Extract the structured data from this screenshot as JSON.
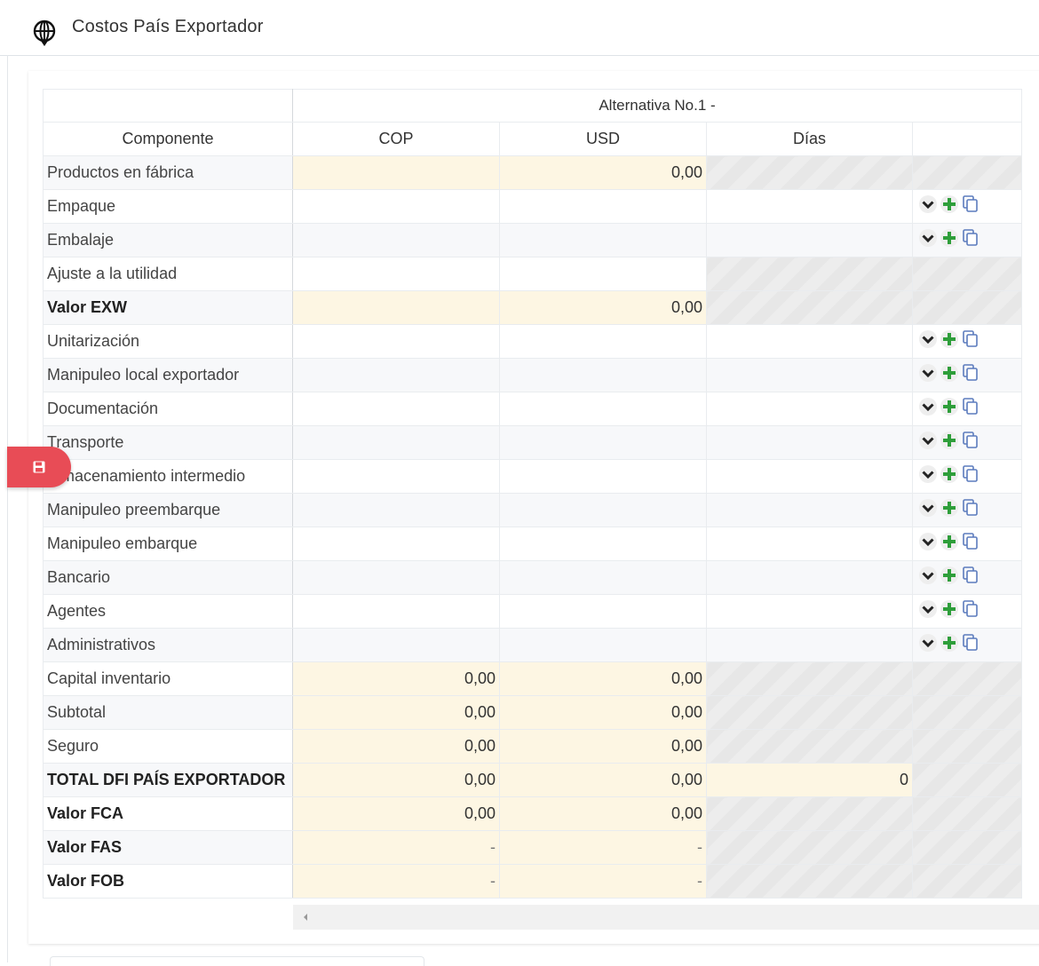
{
  "header": {
    "title": "Costos País Exportador",
    "icon": "globe-icon"
  },
  "table": {
    "alternative_label": "Alternativa No.1 -",
    "columns": [
      "Componente",
      "COP",
      "USD",
      "Días",
      ""
    ],
    "rows": [
      {
        "label": "Productos en fábrica",
        "bold": false,
        "cop": "",
        "usd": "0,00",
        "dias": "",
        "cop_style": "yellow",
        "usd_style": "yellow",
        "dias_style": "hatch",
        "actions": false
      },
      {
        "label": "Empaque",
        "bold": false,
        "cop": "",
        "usd": "",
        "dias": "",
        "cop_style": "plain",
        "usd_style": "plain",
        "dias_style": "plain",
        "actions": true
      },
      {
        "label": "Embalaje",
        "bold": false,
        "cop": "",
        "usd": "",
        "dias": "",
        "cop_style": "plain",
        "usd_style": "plain",
        "dias_style": "plain",
        "actions": true
      },
      {
        "label": "Ajuste a la utilidad",
        "bold": false,
        "cop": "",
        "usd": "",
        "dias": "",
        "cop_style": "plain",
        "usd_style": "plain",
        "dias_style": "hatch",
        "actions": false
      },
      {
        "label": "Valor EXW",
        "bold": true,
        "cop": "",
        "usd": "0,00",
        "dias": "",
        "cop_style": "yellow",
        "usd_style": "yellow",
        "dias_style": "hatch",
        "actions": false
      },
      {
        "label": "Unitarización",
        "bold": false,
        "cop": "",
        "usd": "",
        "dias": "",
        "cop_style": "plain",
        "usd_style": "plain",
        "dias_style": "plain",
        "actions": true
      },
      {
        "label": "Manipuleo local exportador",
        "bold": false,
        "cop": "",
        "usd": "",
        "dias": "",
        "cop_style": "plain",
        "usd_style": "plain",
        "dias_style": "plain",
        "actions": true
      },
      {
        "label": "Documentación",
        "bold": false,
        "cop": "",
        "usd": "",
        "dias": "",
        "cop_style": "plain",
        "usd_style": "plain",
        "dias_style": "plain",
        "actions": true
      },
      {
        "label": "Transporte",
        "bold": false,
        "cop": "",
        "usd": "",
        "dias": "",
        "cop_style": "plain",
        "usd_style": "plain",
        "dias_style": "plain",
        "actions": true
      },
      {
        "label": "Almacenamiento intermedio",
        "bold": false,
        "cop": "",
        "usd": "",
        "dias": "",
        "cop_style": "plain",
        "usd_style": "plain",
        "dias_style": "plain",
        "actions": true
      },
      {
        "label": "Manipuleo preembarque",
        "bold": false,
        "cop": "",
        "usd": "",
        "dias": "",
        "cop_style": "plain",
        "usd_style": "plain",
        "dias_style": "plain",
        "actions": true
      },
      {
        "label": "Manipuleo embarque",
        "bold": false,
        "cop": "",
        "usd": "",
        "dias": "",
        "cop_style": "plain",
        "usd_style": "plain",
        "dias_style": "plain",
        "actions": true
      },
      {
        "label": "Bancario",
        "bold": false,
        "cop": "",
        "usd": "",
        "dias": "",
        "cop_style": "plain",
        "usd_style": "plain",
        "dias_style": "plain",
        "actions": true
      },
      {
        "label": "Agentes",
        "bold": false,
        "cop": "",
        "usd": "",
        "dias": "",
        "cop_style": "plain",
        "usd_style": "plain",
        "dias_style": "plain",
        "actions": true
      },
      {
        "label": "Administrativos",
        "bold": false,
        "cop": "",
        "usd": "",
        "dias": "",
        "cop_style": "plain",
        "usd_style": "plain",
        "dias_style": "plain",
        "actions": true
      },
      {
        "label": "Capital inventario",
        "bold": false,
        "cop": "0,00",
        "usd": "0,00",
        "dias": "",
        "cop_style": "yellow",
        "usd_style": "yellow",
        "dias_style": "hatch",
        "actions": false
      },
      {
        "label": "Subtotal",
        "bold": false,
        "cop": "0,00",
        "usd": "0,00",
        "dias": "",
        "cop_style": "yellow",
        "usd_style": "yellow",
        "dias_style": "hatch",
        "actions": false
      },
      {
        "label": "Seguro",
        "bold": false,
        "cop": "0,00",
        "usd": "0,00",
        "dias": "",
        "cop_style": "yellow",
        "usd_style": "yellow",
        "dias_style": "hatch",
        "actions": false
      },
      {
        "label": "TOTAL DFI PAÍS EXPORTADOR",
        "bold": true,
        "cop": "0,00",
        "usd": "0,00",
        "dias": "0",
        "cop_style": "yellow",
        "usd_style": "yellow",
        "dias_style": "yellow",
        "actions": false
      },
      {
        "label": "Valor FCA",
        "bold": true,
        "cop": "0,00",
        "usd": "0,00",
        "dias": "",
        "cop_style": "yellow",
        "usd_style": "yellow",
        "dias_style": "hatch",
        "actions": false
      },
      {
        "label": "Valor FAS",
        "bold": true,
        "cop": "-",
        "usd": "-",
        "dias": "",
        "cop_style": "yellow",
        "usd_style": "yellow",
        "dias_style": "hatch",
        "actions": false
      },
      {
        "label": "Valor FOB",
        "bold": true,
        "cop": "-",
        "usd": "-",
        "dias": "",
        "cop_style": "yellow",
        "usd_style": "yellow",
        "dias_style": "hatch",
        "actions": false
      }
    ],
    "action_icons": [
      "chevron-down-icon",
      "plus-icon",
      "copy-icon"
    ]
  },
  "fab": {
    "icon": "save-icon",
    "color": "#e84c56"
  },
  "colors": {
    "yellow_cell": "#fdf6e3",
    "plus_green": "#2e9e3a",
    "copy_blue": "#5b7bbd",
    "fab_red": "#e84c56"
  }
}
